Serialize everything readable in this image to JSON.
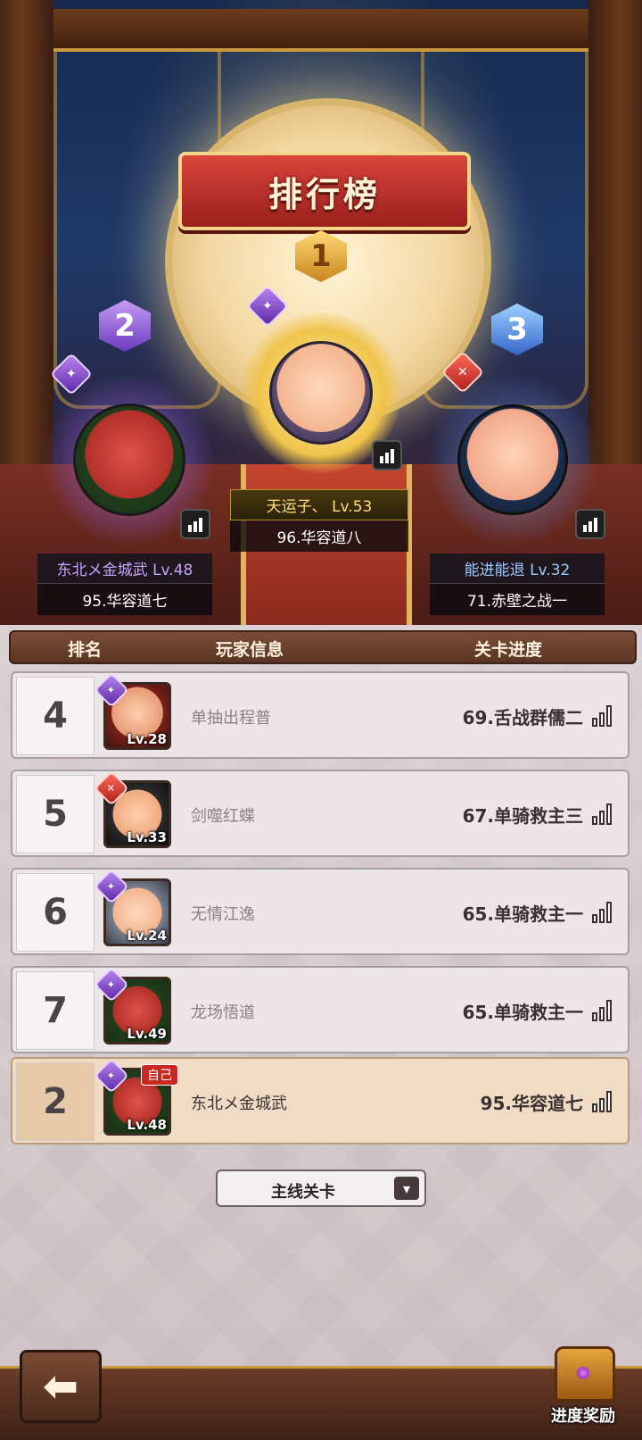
{
  "title": "排行榜",
  "podium": [
    {
      "rank": "1",
      "name": "天运子、",
      "level": "Lv.53",
      "stage": "96.华容道八"
    },
    {
      "rank": "2",
      "name": "东北メ金城武",
      "level": "Lv.48",
      "stage": "95.华容道七"
    },
    {
      "rank": "3",
      "name": "能进能退",
      "level": "Lv.32",
      "stage": "71.赤壁之战一"
    }
  ],
  "table_header": {
    "rank": "排名",
    "player": "玩家信息",
    "progress": "关卡进度"
  },
  "rows": [
    {
      "rank": "4",
      "level": "Lv.28",
      "name": "单抽出程普",
      "stage": "69.舌战群儒二",
      "class_color": "purple"
    },
    {
      "rank": "5",
      "level": "Lv.33",
      "name": "剑噬红蝶",
      "stage": "67.单骑救主三",
      "class_color": "red"
    },
    {
      "rank": "6",
      "level": "Lv.24",
      "name": "无情江逸",
      "stage": "65.单骑救主一",
      "class_color": "purple"
    },
    {
      "rank": "7",
      "level": "Lv.49",
      "name": "龙场悟道",
      "stage": "65.单骑救主一",
      "class_color": "purple"
    }
  ],
  "self_row": {
    "rank": "2",
    "level": "Lv.48",
    "name": "东北メ金城武",
    "stage": "95.华容道七",
    "tag": "自己"
  },
  "dropdown": {
    "selected": "主线关卡"
  },
  "buttons": {
    "back": "back-arrow",
    "reward_label": "进度奖励"
  },
  "colors": {
    "accent_red": "#c7281f",
    "gold": "#e0b45c",
    "purple": "#7b3fc4",
    "blue": "#3467c9"
  }
}
